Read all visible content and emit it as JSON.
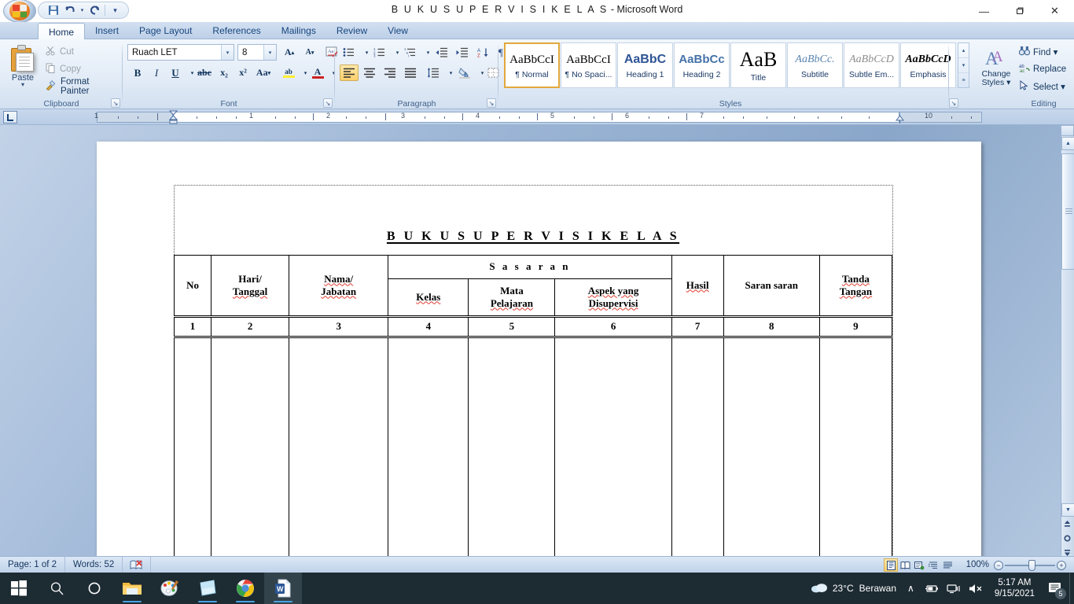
{
  "window": {
    "doc_name": "B U K U  S U P E R V I S I  K E L A S",
    "app_suffix": " - Microsoft Word",
    "minimize": "—",
    "restore": "❐",
    "close": "✕"
  },
  "quick_access": {
    "save": "💾",
    "undo": "↶",
    "undo_caret": "▾",
    "redo": "↻",
    "customize": "☰"
  },
  "ribbon": {
    "tabs": [
      {
        "label": "Home",
        "active": true
      },
      {
        "label": "Insert",
        "active": false
      },
      {
        "label": "Page Layout",
        "active": false
      },
      {
        "label": "References",
        "active": false
      },
      {
        "label": "Mailings",
        "active": false
      },
      {
        "label": "Review",
        "active": false
      },
      {
        "label": "View",
        "active": false
      }
    ],
    "clipboard": {
      "group_label": "Clipboard",
      "paste_label": "Paste",
      "paste_caret": "▾",
      "cut_label": "Cut",
      "copy_label": "Copy",
      "format_painter_label": "Format Painter",
      "cut_icon": "✂",
      "copy_icon": "⧉",
      "painter_icon": "🖌",
      "dialog_launcher": "↘"
    },
    "font": {
      "group_label": "Font",
      "font_name": "Ruach LET",
      "font_size": "8",
      "grow_font": "A▴",
      "shrink_font": "A▾",
      "clear_formatting": "Aa",
      "bold": "B",
      "italic": "I",
      "underline": "U",
      "strikethrough": "abc",
      "subscript": "x₂",
      "superscript": "x²",
      "change_case": "Aa",
      "highlight": "ab",
      "font_color": "A",
      "dialog_launcher": "↘"
    },
    "paragraph": {
      "group_label": "Paragraph",
      "bullets": "☰",
      "numbering": "≡",
      "multilevel": "≣",
      "decrease_indent": "⇤",
      "increase_indent": "⇥",
      "sort": "A↓",
      "show_marks": "¶",
      "align_left": "≡",
      "align_center": "≡",
      "align_right": "≡",
      "justify": "≡",
      "line_spacing": "↕",
      "shading": "▣",
      "borders": "⊞",
      "dialog_launcher": "↘"
    },
    "styles": {
      "group_label": "Styles",
      "items": [
        {
          "preview": "AaBbCcI",
          "name": "¶ Normal",
          "selected": true
        },
        {
          "preview": "AaBbCcI",
          "name": "¶ No Spaci...",
          "selected": false
        },
        {
          "preview": "AaBbC",
          "name": "Heading 1",
          "selected": false
        },
        {
          "preview": "AaBbCc",
          "name": "Heading 2",
          "selected": false
        },
        {
          "preview": "AaB",
          "name": "Title",
          "selected": false
        },
        {
          "preview": "AaBbCc.",
          "name": "Subtitle",
          "selected": false
        },
        {
          "preview": "AaBbCcD",
          "name": "Subtle Em...",
          "selected": false
        },
        {
          "preview": "AaBbCcD",
          "name": "Emphasis",
          "selected": false
        }
      ],
      "scroll_up": "▴",
      "scroll_down": "▾",
      "more": "≡",
      "change_styles_label_1": "Change",
      "change_styles_label_2": "Styles ▾",
      "change_styles_icon": "A",
      "dialog_launcher": "↘"
    },
    "editing": {
      "group_label": "Editing",
      "find_label": "Find ▾",
      "replace_label": "Replace",
      "select_label": "Select ▾",
      "find_icon": "🔍",
      "replace_icon": "ab",
      "select_icon": "↖"
    }
  },
  "ruler": {
    "tab_selector": "L",
    "numbers": [
      "1",
      "1",
      "2",
      "3",
      "4",
      "5",
      "6",
      "7",
      "10"
    ]
  },
  "document": {
    "title": "B U K U   S U P E R V I S I   K E L A S",
    "table": {
      "headers_row1": [
        "No",
        "Hari/ Tanggal",
        "Nama/ Jabatan",
        "Sasaran",
        "Hasil",
        "Saran saran",
        "Tanda Tangan"
      ],
      "col_no": "No",
      "col_hari_1": "Hari/",
      "col_hari_2": "Tanggal",
      "col_nama_1": "Nama/",
      "col_nama_2": "Jabatan",
      "col_sasaran": "S a s a r a n",
      "col_kelas": "Kelas",
      "col_mata_1": "Mata",
      "col_mata_2": "Pelajaran",
      "col_aspek_1": "Aspek yang",
      "col_aspek_2": "Disupervisi",
      "col_hasil": "Hasil",
      "col_saran": "Saran saran",
      "col_tanda_1": "Tanda",
      "col_tanda_2": "Tangan",
      "numbering_row": [
        "1",
        "2",
        "3",
        "4",
        "5",
        "6",
        "7",
        "8",
        "9"
      ]
    }
  },
  "statusbar": {
    "page_label": "Page: 1 of 2",
    "words_label": "Words: 52",
    "proofing_icon": "📖",
    "zoom_level": "100%",
    "zoom_out": "−",
    "zoom_in": "+",
    "view_buttons": [
      "print-layout",
      "full-screen-reading",
      "web-layout",
      "outline",
      "draft"
    ]
  },
  "taskbar": {
    "start": "start-icon",
    "search": "search-icon",
    "cortana": "cortana-icon",
    "explorer": "file-explorer-icon",
    "paint": "paint-icon",
    "sticky": "sticky-notes-icon",
    "chrome": "chrome-icon",
    "word": "word-icon",
    "weather_temp": "23°C",
    "weather_desc": "Berawan",
    "tray_up": "∧",
    "tray_battery": "🔋",
    "tray_network": "🖧",
    "tray_volume": "🔇",
    "time": "5:17 AM",
    "date": "9/15/2021",
    "notif_count": "5"
  }
}
